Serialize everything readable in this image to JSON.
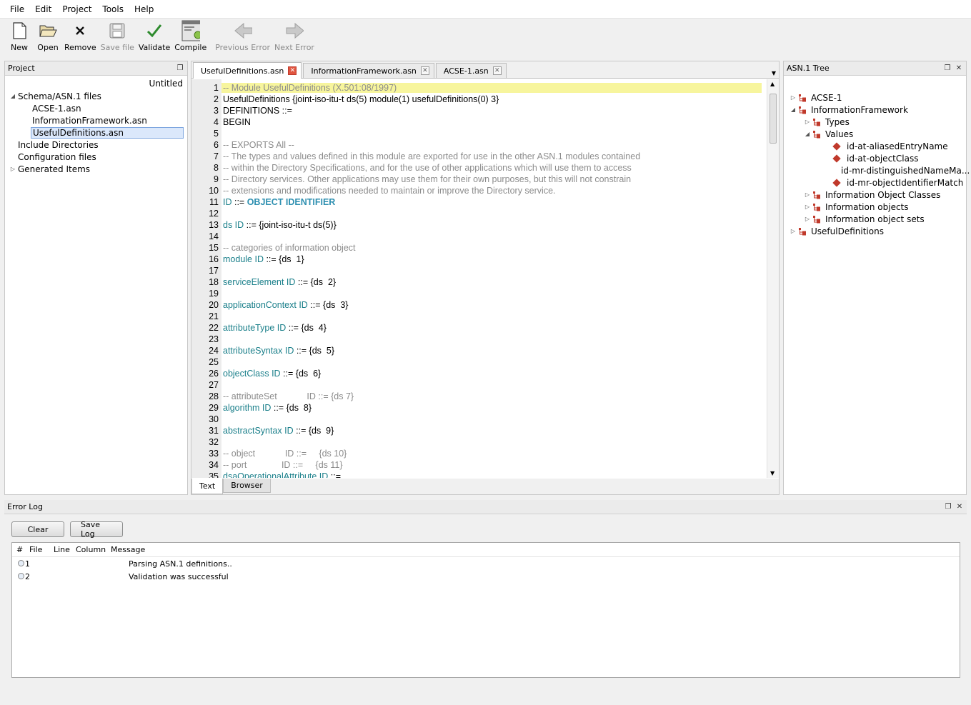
{
  "menu": [
    "File",
    "Edit",
    "Project",
    "Tools",
    "Help"
  ],
  "toolbar": {
    "new": "New",
    "open": "Open",
    "remove": "Remove",
    "save": "Save file",
    "validate": "Validate",
    "compile": "Compile",
    "prev_error": "Previous Error",
    "next_error": "Next Error"
  },
  "project": {
    "title": "Project",
    "name": "Untitled",
    "items": {
      "schema": "Schema/ASN.1 files",
      "acse": "ACSE-1.asn",
      "infofw": "InformationFramework.asn",
      "useful": "UsefulDefinitions.asn",
      "include": "Include Directories",
      "config": "Configuration files",
      "generated": "Generated Items"
    }
  },
  "editor": {
    "tabs": [
      "UsefulDefinitions.asn",
      "InformationFramework.asn",
      "ACSE-1.asn"
    ],
    "bottom_tabs": [
      "Text",
      "Browser"
    ],
    "lines": [
      {
        "n": "1",
        "t": "-- Module UsefulDefinitions (X.501:08/1997)"
      },
      {
        "n": "2",
        "t": "UsefulDefinitions {joint-iso-itu-t ds(5) module(1) usefulDefinitions(0) 3}"
      },
      {
        "n": "3",
        "t": "DEFINITIONS ::="
      },
      {
        "n": "4",
        "t": "BEGIN"
      },
      {
        "n": "5",
        "t": ""
      },
      {
        "n": "6",
        "t": "-- EXPORTS All --"
      },
      {
        "n": "7",
        "t": "-- The types and values defined in this module are exported for use in the other ASN.1 modules contained"
      },
      {
        "n": "8",
        "t": "-- within the Directory Specifications, and for the use of other applications which will use them to access"
      },
      {
        "n": "9",
        "t": "-- Directory services. Other applications may use them for their own purposes, but this will not constrain"
      },
      {
        "n": "10",
        "t": "-- extensions and modifications needed to maintain or improve the Directory service."
      },
      {
        "n": "11",
        "a": "ID",
        "b": " ::= ",
        "k": "OBJECT IDENTIFIER"
      },
      {
        "n": "12",
        "t": ""
      },
      {
        "n": "13",
        "a": "ds ID",
        "b": " ::= {joint-iso-itu-t ds(5)}"
      },
      {
        "n": "14",
        "t": ""
      },
      {
        "n": "15",
        "t": "-- categories of information object"
      },
      {
        "n": "16",
        "a": "module ID",
        "b": " ::= {ds  1}"
      },
      {
        "n": "17",
        "t": ""
      },
      {
        "n": "18",
        "a": "serviceElement ID",
        "b": " ::= {ds  2}"
      },
      {
        "n": "19",
        "t": ""
      },
      {
        "n": "20",
        "a": "applicationContext ID",
        "b": " ::= {ds  3}"
      },
      {
        "n": "21",
        "t": ""
      },
      {
        "n": "22",
        "a": "attributeType ID",
        "b": " ::= {ds  4}"
      },
      {
        "n": "23",
        "t": ""
      },
      {
        "n": "24",
        "a": "attributeSyntax ID",
        "b": " ::= {ds  5}"
      },
      {
        "n": "25",
        "t": ""
      },
      {
        "n": "26",
        "a": "objectClass ID",
        "b": " ::= {ds  6}"
      },
      {
        "n": "27",
        "t": ""
      },
      {
        "n": "28",
        "t": "-- attributeSet            ID ::= {ds 7}"
      },
      {
        "n": "29",
        "a": "algorithm ID",
        "b": " ::= {ds  8}"
      },
      {
        "n": "30",
        "t": ""
      },
      {
        "n": "31",
        "a": "abstractSyntax ID",
        "b": " ::= {ds  9}"
      },
      {
        "n": "32",
        "t": ""
      },
      {
        "n": "33",
        "t": "-- object            ID ::=     {ds 10}"
      },
      {
        "n": "34",
        "t": "-- port              ID ::=     {ds 11}"
      },
      {
        "n": "35",
        "a": "dsaOperationalAttribute ID",
        "b": " ::="
      }
    ]
  },
  "asn_tree": {
    "title": "ASN.1 Tree",
    "acse": "ACSE-1",
    "infofw": "InformationFramework",
    "types": "Types",
    "values": "Values",
    "v1": "id-at-aliasedEntryName",
    "v2": "id-at-objectClass",
    "v3": "id-mr-distinguishedNameMa...",
    "v4": "id-mr-objectIdentifierMatch",
    "ioc": "Information Object Classes",
    "io": "Information objects",
    "ios": "Information object sets",
    "useful": "UsefulDefinitions"
  },
  "error_log": {
    "title": "Error Log",
    "clear": "Clear",
    "save": "Save Log",
    "headers": [
      "#",
      "File",
      "Line",
      "Column",
      "Message"
    ],
    "rows": [
      {
        "n": "1",
        "msg": "Parsing ASN.1 definitions.."
      },
      {
        "n": "2",
        "msg": "Validation was successful"
      }
    ]
  }
}
